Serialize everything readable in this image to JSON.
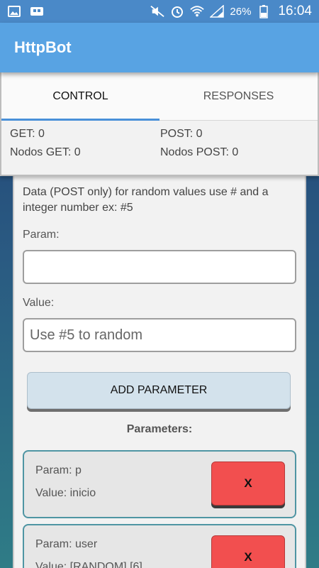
{
  "status_bar": {
    "icons_left": [
      "image-icon",
      "notification-icon"
    ],
    "icons_right": [
      "mute-icon",
      "alarm-icon",
      "wifi-icon",
      "signal-icon"
    ],
    "battery": "26%",
    "time": "16:04"
  },
  "app": {
    "title": "HttpBot",
    "bar_color": "#58a3e3"
  },
  "tabs": [
    {
      "label": "CONTROL",
      "active": true
    },
    {
      "label": "RESPONSES",
      "active": false
    }
  ],
  "stats": {
    "get": "GET: 0",
    "post": "POST: 0",
    "nodos_get": "Nodos GET: 0",
    "nodos_post": "Nodos POST: 0"
  },
  "form": {
    "hint": "Data (POST only) for random values use # and a integer number ex: #5",
    "param_label": "Param:",
    "param_value": "",
    "value_label": "Value:",
    "value_placeholder": "Use #5 to random",
    "add_button": "ADD PARAMETER",
    "parameters_title": "Parameters:"
  },
  "parameters": [
    {
      "param": "Param: p",
      "value": "Value: inicio",
      "delete": "X"
    },
    {
      "param": "Param: user",
      "value": "Value: [RANDOM] [6]",
      "delete": "X"
    }
  ],
  "colors": {
    "accent": "#4a90d9",
    "delete": "#f24f4f",
    "card_border": "#4f95a3"
  }
}
